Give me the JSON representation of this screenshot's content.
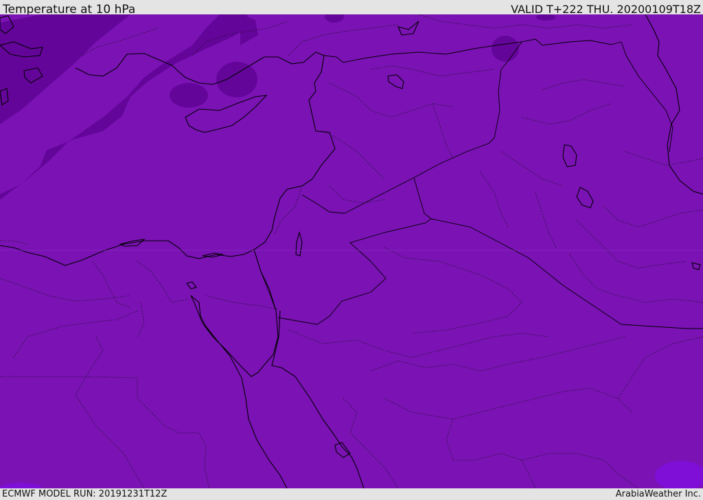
{
  "header": {
    "title": "Temperature at 10 hPa",
    "valid": "VALID T+222 THU. 20200109T18Z"
  },
  "footer": {
    "model_run": "ECMWF MODEL RUN: 20191231T12Z",
    "credit": "ArabiaWeather Inc."
  },
  "map": {
    "field": "Temperature at 10 hPa",
    "colors": {
      "base_fill": "#7a12b4",
      "cold_band": "#64059a",
      "lighter_patch": "#7f0fd6",
      "coastline": "#000000",
      "borders": "#000000"
    }
  }
}
